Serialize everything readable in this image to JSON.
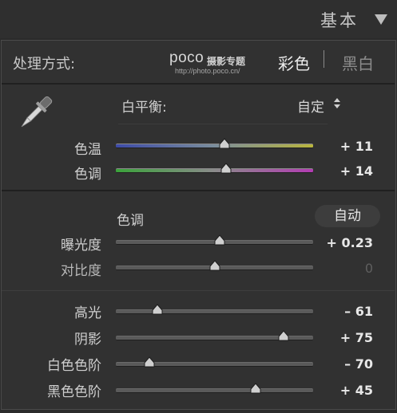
{
  "panel": {
    "title": "基本"
  },
  "treatment": {
    "label": "处理方式:",
    "options": [
      {
        "label": "彩色",
        "selected": true
      },
      {
        "label": "黑白",
        "selected": false
      }
    ]
  },
  "watermark": {
    "logo": "poco",
    "text": "摄影专题",
    "url": "http://photo.poco.cn/"
  },
  "white_balance": {
    "label": "白平衡:",
    "value": "自定"
  },
  "wb_sliders": [
    {
      "label": "色温",
      "value": "+ 11",
      "position": 0.55
    },
    {
      "label": "色调",
      "value": "+ 14",
      "position": 0.56
    }
  ],
  "tone": {
    "label": "色调",
    "auto_label": "自动"
  },
  "tone_sliders": [
    {
      "label": "曝光度",
      "value": "+ 0.23",
      "position": 0.525
    },
    {
      "label": "对比度",
      "value": "0",
      "position": 0.5
    }
  ],
  "presence_sliders": [
    {
      "label": "高光",
      "value": "– 61",
      "position": 0.21
    },
    {
      "label": "阴影",
      "value": "+ 75",
      "position": 0.85
    },
    {
      "label": "白色色阶",
      "value": "– 70",
      "position": 0.17
    },
    {
      "label": "黑色色阶",
      "value": "+ 45",
      "position": 0.71
    }
  ],
  "colors": {
    "background": "#2b2b2b",
    "panel": "#313131",
    "text": "#cfcfcf",
    "value_text": "#e8e8e8",
    "thumb": "#cfcfcf"
  }
}
